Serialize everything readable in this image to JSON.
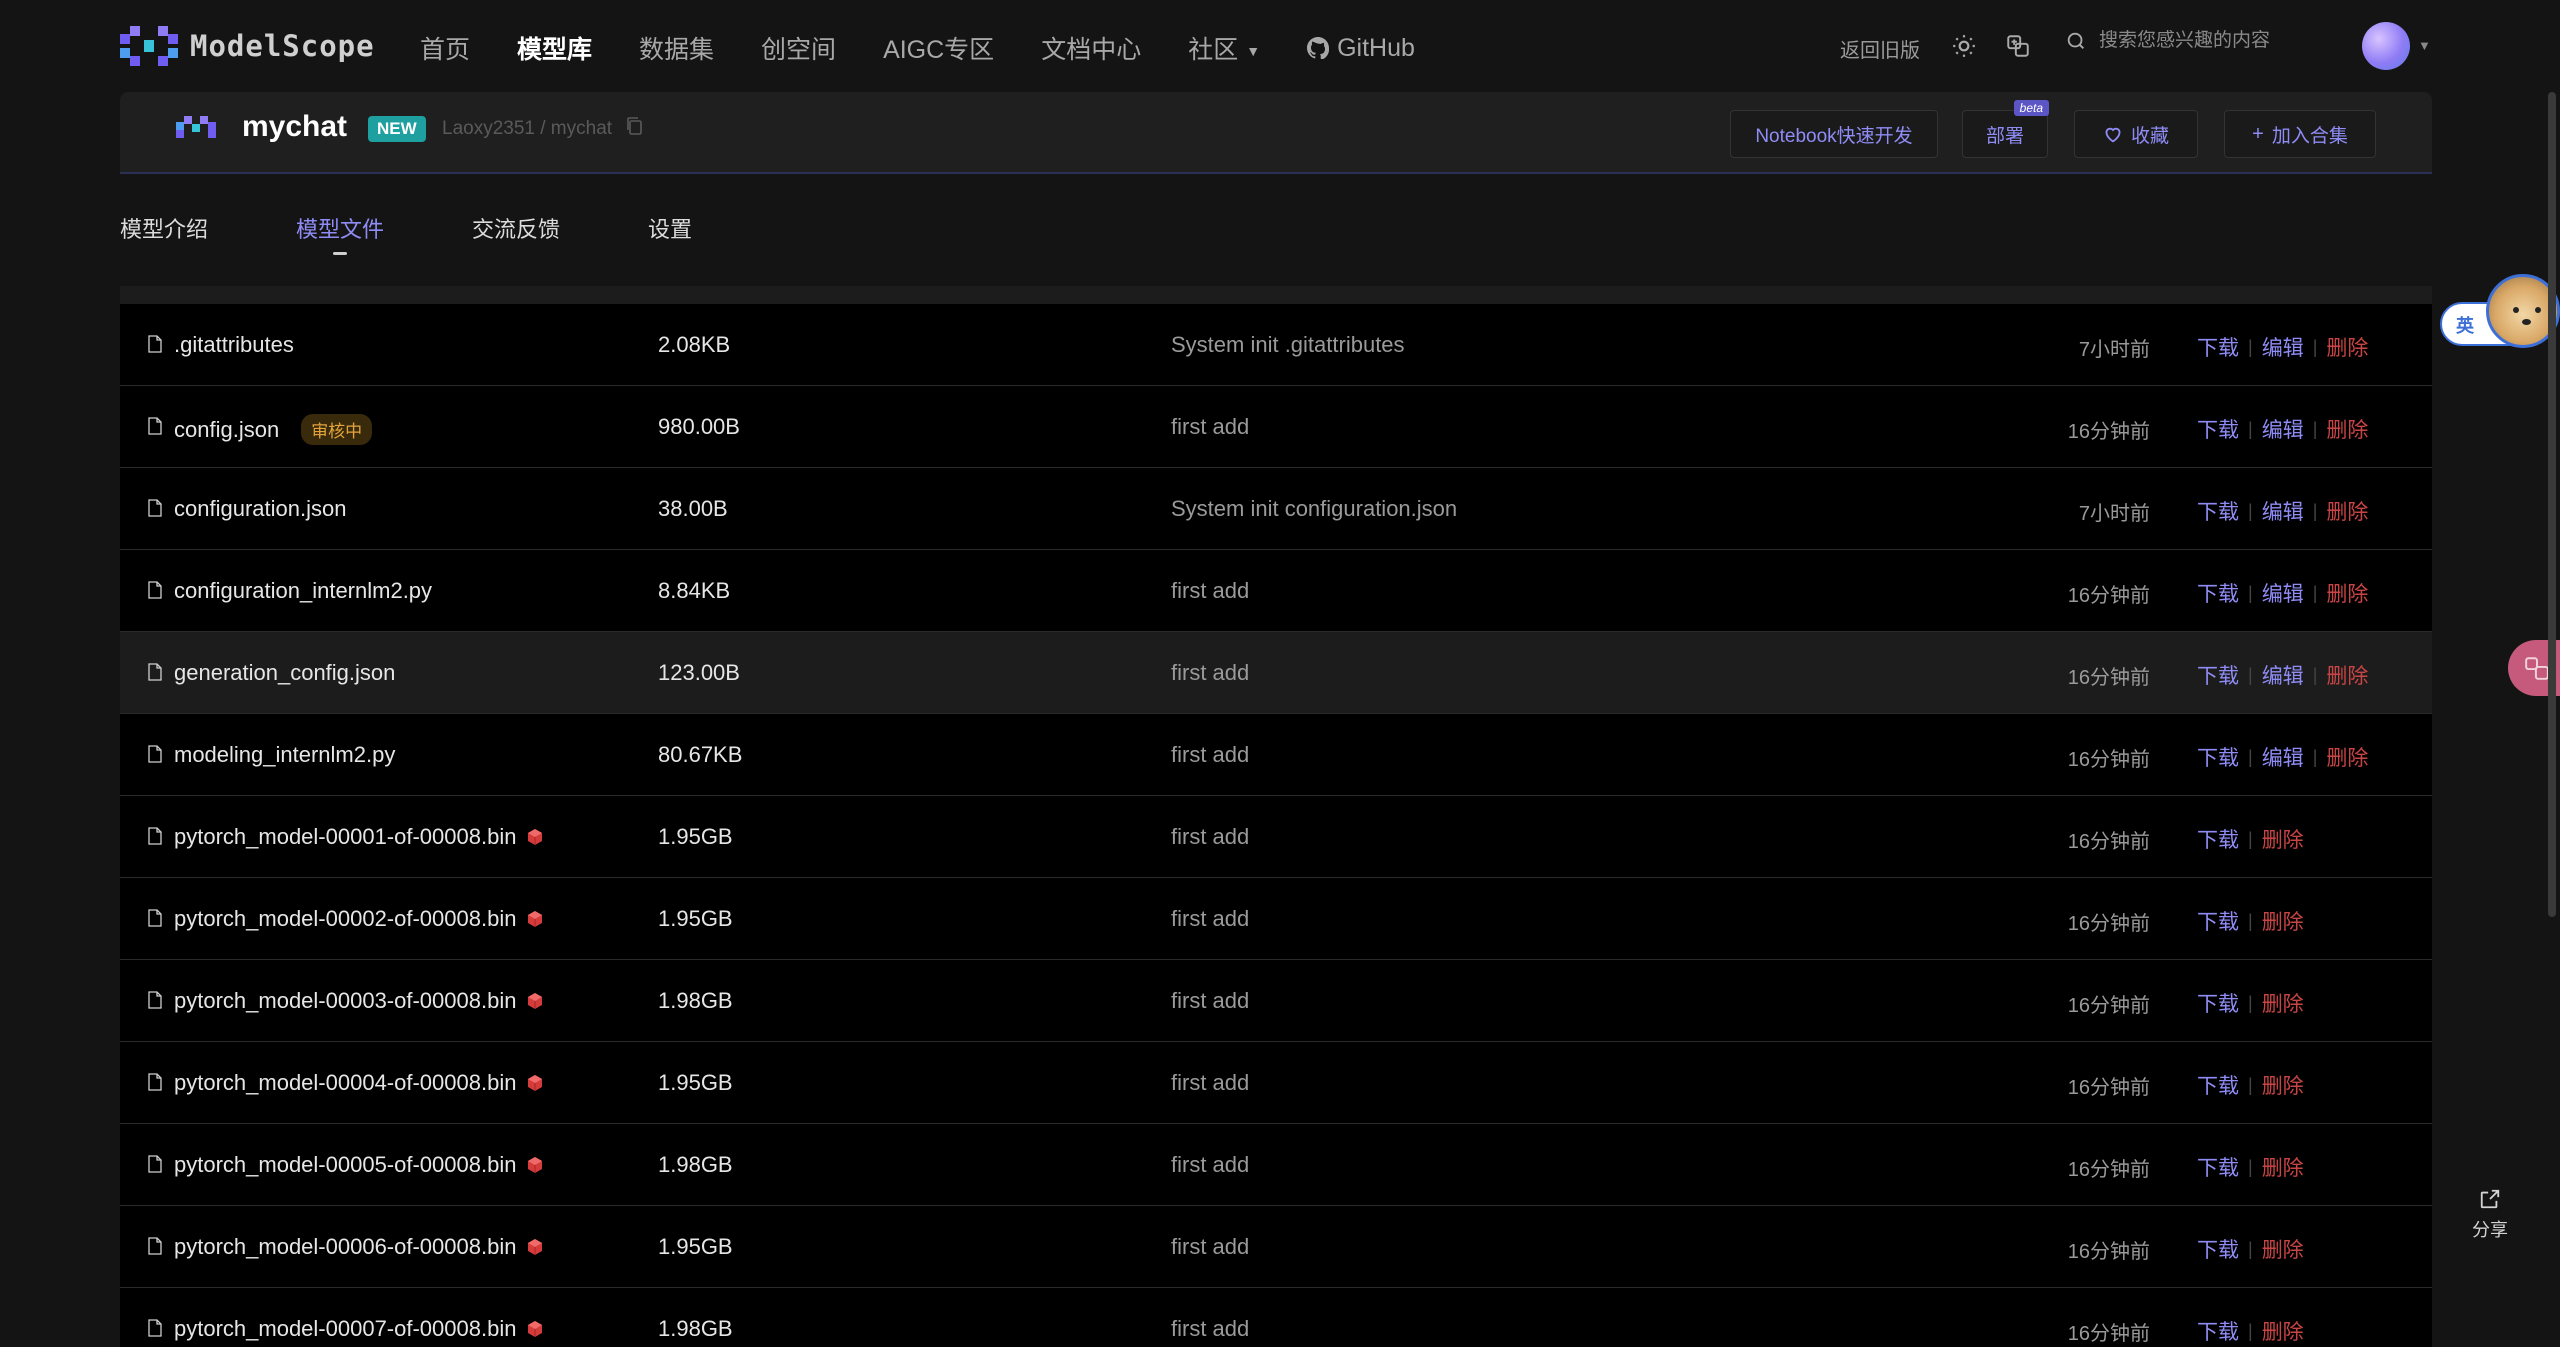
{
  "nav": {
    "logo_text": "ModelScope",
    "items": [
      {
        "label": "首页",
        "active": false
      },
      {
        "label": "模型库",
        "active": true
      },
      {
        "label": "数据集",
        "active": false
      },
      {
        "label": "创空间",
        "active": false
      },
      {
        "label": "AIGC专区",
        "active": false
      },
      {
        "label": "文档中心",
        "active": false
      },
      {
        "label": "社区",
        "active": false
      },
      {
        "label": "GitHub",
        "active": false
      }
    ],
    "old_version": "返回旧版",
    "search_placeholder": "搜索您感兴趣的内容"
  },
  "model": {
    "name": "mychat",
    "badge": "NEW",
    "path": "Laoxy2351 / mychat",
    "buttons": {
      "notebook": "Notebook快速开发",
      "deploy": "部署",
      "deploy_badge": "beta",
      "favorite": "收藏",
      "add_collection": "加入合集"
    }
  },
  "tabs": [
    {
      "label": "模型介绍",
      "active": false
    },
    {
      "label": "模型文件",
      "active": true
    },
    {
      "label": "交流反馈",
      "active": false
    },
    {
      "label": "设置",
      "active": false
    }
  ],
  "actions": {
    "download": "下载",
    "edit": "编辑",
    "delete": "删除"
  },
  "files": [
    {
      "name": ".gitattributes",
      "size": "2.08KB",
      "message": "System init .gitattributes",
      "time": "7小时前",
      "editable": true,
      "lfs": false,
      "review": ""
    },
    {
      "name": "config.json",
      "size": "980.00B",
      "message": "first add",
      "time": "16分钟前",
      "editable": true,
      "lfs": false,
      "review": "审核中"
    },
    {
      "name": "configuration.json",
      "size": "38.00B",
      "message": "System init configuration.json",
      "time": "7小时前",
      "editable": true,
      "lfs": false,
      "review": ""
    },
    {
      "name": "configuration_internlm2.py",
      "size": "8.84KB",
      "message": "first add",
      "time": "16分钟前",
      "editable": true,
      "lfs": false,
      "review": ""
    },
    {
      "name": "generation_config.json",
      "size": "123.00B",
      "message": "first add",
      "time": "16分钟前",
      "editable": true,
      "lfs": false,
      "review": ""
    },
    {
      "name": "modeling_internlm2.py",
      "size": "80.67KB",
      "message": "first add",
      "time": "16分钟前",
      "editable": true,
      "lfs": false,
      "review": ""
    },
    {
      "name": "pytorch_model-00001-of-00008.bin",
      "size": "1.95GB",
      "message": "first add",
      "time": "16分钟前",
      "editable": false,
      "lfs": true,
      "review": ""
    },
    {
      "name": "pytorch_model-00002-of-00008.bin",
      "size": "1.95GB",
      "message": "first add",
      "time": "16分钟前",
      "editable": false,
      "lfs": true,
      "review": ""
    },
    {
      "name": "pytorch_model-00003-of-00008.bin",
      "size": "1.98GB",
      "message": "first add",
      "time": "16分钟前",
      "editable": false,
      "lfs": true,
      "review": ""
    },
    {
      "name": "pytorch_model-00004-of-00008.bin",
      "size": "1.95GB",
      "message": "first add",
      "time": "16分钟前",
      "editable": false,
      "lfs": true,
      "review": ""
    },
    {
      "name": "pytorch_model-00005-of-00008.bin",
      "size": "1.98GB",
      "message": "first add",
      "time": "16分钟前",
      "editable": false,
      "lfs": true,
      "review": ""
    },
    {
      "name": "pytorch_model-00006-of-00008.bin",
      "size": "1.95GB",
      "message": "first add",
      "time": "16分钟前",
      "editable": false,
      "lfs": true,
      "review": ""
    },
    {
      "name": "pytorch_model-00007-of-00008.bin",
      "size": "1.98GB",
      "message": "first add",
      "time": "16分钟前",
      "editable": false,
      "lfs": true,
      "review": ""
    }
  ],
  "floating": {
    "translate_label": "英",
    "share_label": "分享"
  },
  "colors": {
    "accent": "#8f8cf5",
    "danger": "#c94545",
    "new_badge": "#1fa0a0",
    "review": "#e2a43b"
  }
}
